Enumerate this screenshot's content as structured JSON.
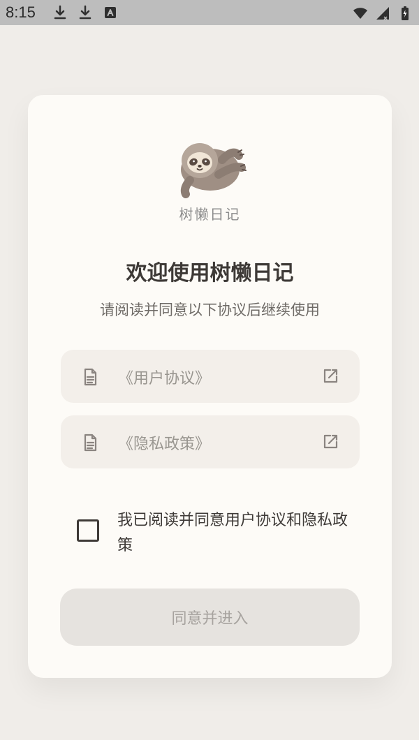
{
  "status_bar": {
    "time": "8:15",
    "left_icons": [
      "download-icon",
      "download-icon",
      "text-notification-icon"
    ],
    "right_icons": [
      "wifi-icon",
      "signal-icon",
      "battery-icon"
    ]
  },
  "app": {
    "logo_text": "树懒日记",
    "title": "欢迎使用树懒日记",
    "subtitle": "请阅读并同意以下协议后继续使用"
  },
  "documents": [
    {
      "label": "《用户协议》",
      "icon": "document-icon",
      "action_icon": "open-external-icon"
    },
    {
      "label": "《隐私政策》",
      "icon": "document-icon",
      "action_icon": "open-external-icon"
    }
  ],
  "consent": {
    "label": "我已阅读并同意用户协议和隐私政策",
    "checked": false
  },
  "buttons": {
    "enter_label": "同意并进入"
  },
  "colors": {
    "background": "#f0ede9",
    "card": "#fdfbf7",
    "item_bg": "#f3efea",
    "disabled_button": "#e6e3df",
    "disabled_text": "#a7a39f",
    "title_text": "#3d3936"
  }
}
